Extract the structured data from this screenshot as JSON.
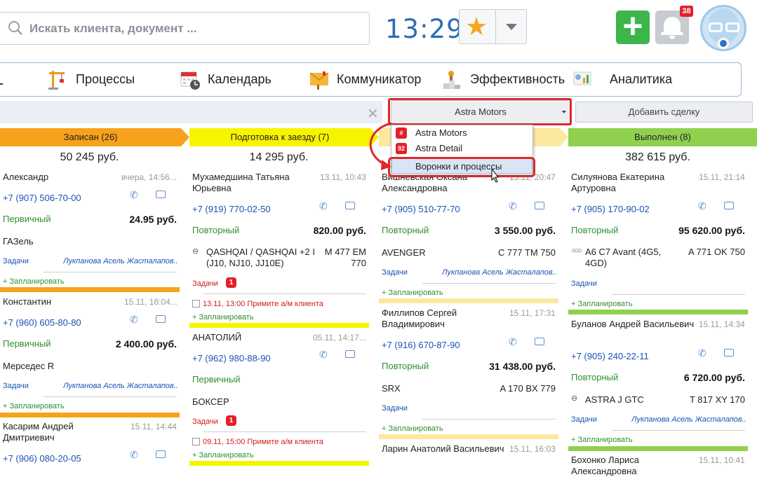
{
  "topbar": {
    "search_placeholder": "Искать клиента, документ ...",
    "clock": "13:29",
    "notifications_count": "38"
  },
  "nav": {
    "items": [
      {
        "label": "Процессы",
        "icon": "crane-icon"
      },
      {
        "label": "Календарь",
        "icon": "calendar-icon"
      },
      {
        "label": "Коммуникатор",
        "icon": "envelope-icon"
      },
      {
        "label": "Эффективность",
        "icon": "podium-icon"
      },
      {
        "label": "Аналитика",
        "icon": "analytics-icon"
      }
    ]
  },
  "filter": {
    "funnel_selected": "Astra Motors",
    "add_deal": "Добавить сделку"
  },
  "dropdown": {
    "items": [
      {
        "badge": "#",
        "label": "Astra Motors"
      },
      {
        "badge": "92",
        "label": "Astra Detail"
      },
      {
        "badge": "",
        "label": "Воронки и процессы"
      }
    ]
  },
  "columns": [
    {
      "stage": "Записан (26)",
      "color": "#f7a21b",
      "total": "50 245 руб.",
      "cards": [
        {
          "name": "Александр",
          "time": "вчера, 14:56...",
          "phone": "+7 (907) 506-70-00",
          "type": "Первичный",
          "price": "24.95 руб.",
          "car": "ГАЗель",
          "plate": "",
          "tasks": "Задачи",
          "resp": "Лукпанова Асель Жасталапов...",
          "plan": "+ Запланировать"
        },
        {
          "name": "Константин",
          "time": "15.11, 18:04...",
          "phone": "+7 (960) 605-80-80",
          "type": "Первичный",
          "price": "2 400.00 руб.",
          "car": "Мерседес R",
          "plate": "",
          "tasks": "Задачи",
          "resp": "Лукпанова Асель Жасталапов...",
          "plan": "+ Запланировать"
        },
        {
          "name": "Касарим Андрей Дмитриевич",
          "time": "15.11, 14:44",
          "phone": "+7 (906) 080-20-05"
        }
      ]
    },
    {
      "stage": "Подготовка к заезду (7)",
      "color": "#f7f400",
      "total": "14 295 руб.",
      "cards": [
        {
          "name": "Мухамедшина Татьяна Юрьевна",
          "time": "13.11, 10:43",
          "phone": "+7 (919) 770-02-50",
          "type": "Повторный",
          "price": "820.00 руб.",
          "car": "QASHQAI / QASHQAI +2 I (J10, NJ10, JJ10E)",
          "plate": "M 477 EM 770",
          "tasks": "Задачи",
          "tasks_count": "1",
          "todo": "13.11, 13:00 Примите а/м клиента",
          "plan": "+ Запланировать"
        },
        {
          "name": "АНАТОЛИЙ",
          "time": "05.11, 14:17...",
          "phone": "+7 (962) 980-88-90",
          "type": "Первичный",
          "car": "БОКСЕР",
          "tasks": "Задачи",
          "tasks_count": "1",
          "todo": "09.11, 15:00 Примите а/м клиента",
          "plan": "+ Запланировать"
        }
      ]
    },
    {
      "stage": "",
      "color": "#fbe9a0",
      "total": "",
      "cards": [
        {
          "name": "Вишневская Оксана Александровна",
          "time": "15.11, 20:47",
          "phone": "+7 (905) 510-77-70",
          "type": "Повторный",
          "price": "3 550.00 руб.",
          "car": "AVENGER",
          "plate": "C 777 TM 750",
          "tasks": "Задачи",
          "resp": "Лукпанова Асель Жасталапов...",
          "plan": "+ Запланировать"
        },
        {
          "name": "Филлипов Сергей Владимирович",
          "time": "15.11, 17:31",
          "phone": "+7 (916) 670-87-90",
          "type": "Повторный",
          "price": "31 438.00 руб.",
          "car": "SRX",
          "plate": "A 170 BX 779",
          "tasks": "Задачи",
          "plan": "+ Запланировать"
        },
        {
          "name": "Ларин Анатолий Васильевич",
          "time": "15.11, 16:03"
        }
      ]
    },
    {
      "stage": "Выполнен (8)",
      "color": "#8fd14f",
      "total": "382 615 руб.",
      "cards": [
        {
          "name": "Силуянова Екатерина Артуровна",
          "time": "15.11, 21:14",
          "phone": "+7 (905) 170-90-02",
          "type": "Повторный",
          "price": "95 620.00 руб.",
          "car": "A6 C7 Avant (4G5, 4GD)",
          "plate": "A 771 OK 750",
          "tasks": "Задачи",
          "plan": "+ Запланировать"
        },
        {
          "name": "Буланов Андрей Васильевич",
          "time": "15.11, 14:34",
          "phone": "+7 (905) 240-22-11",
          "type": "Повторный",
          "price": "6 720.00 руб.",
          "car": "ASTRA J GTC",
          "plate": "T 817 XY 170",
          "tasks": "Задачи",
          "resp": "Лукпанова Асель Жасталапов...",
          "plan": "+ Запланировать"
        },
        {
          "name": "Бохонко Лариса Александровна",
          "time": "15.11, 10:41"
        }
      ]
    }
  ]
}
